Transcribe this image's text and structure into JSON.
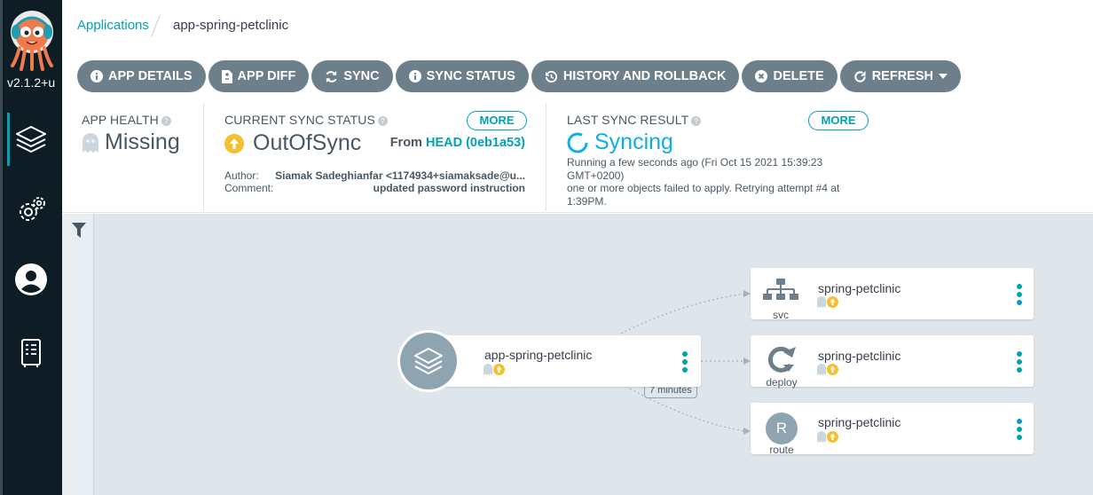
{
  "sidebar": {
    "version": "v2.1.2+u",
    "items": [
      {
        "name": "applications",
        "icon": "layers-icon",
        "active": true
      },
      {
        "name": "settings",
        "icon": "gears-icon",
        "active": false
      },
      {
        "name": "user-info",
        "icon": "user-icon",
        "active": false
      },
      {
        "name": "docs",
        "icon": "docs-icon",
        "active": false
      }
    ]
  },
  "breadcrumb": {
    "root": "Applications",
    "current": "app-spring-petclinic"
  },
  "toolbar": {
    "app_details": "APP DETAILS",
    "app_diff": "APP DIFF",
    "sync": "SYNC",
    "sync_status": "SYNC STATUS",
    "history": "HISTORY AND ROLLBACK",
    "delete": "DELETE",
    "refresh": "REFRESH"
  },
  "status": {
    "health": {
      "label": "APP HEALTH",
      "value": "Missing"
    },
    "sync": {
      "label": "CURRENT SYNC STATUS",
      "more": "MORE",
      "value": "OutOfSync",
      "from_prefix": "From",
      "revision": "HEAD (0eb1a53)",
      "author_label": "Author:",
      "author": "Siamak Sadeghianfar <1174934+siamaksade@u...",
      "comment_label": "Comment:",
      "comment": "updated password instruction"
    },
    "last_sync": {
      "label": "LAST SYNC RESULT",
      "more": "MORE",
      "value": "Syncing",
      "message": "Running a few seconds ago (Fri Oct 15 2021 15:39:23 GMT+0200)",
      "message2": "one or more objects failed to apply. Retrying attempt #4 at 1:39PM."
    }
  },
  "graph": {
    "app_node": {
      "title": "app-spring-petclinic"
    },
    "edge_label": "7 minutes",
    "resources": [
      {
        "title": "spring-petclinic",
        "kind": "svc",
        "icon": "svc-icon"
      },
      {
        "title": "spring-petclinic",
        "kind": "deploy",
        "icon": "deploy-icon"
      },
      {
        "title": "spring-petclinic",
        "kind": "route",
        "icon": "route-icon",
        "letter": "R"
      }
    ]
  },
  "colors": {
    "sidebar_bg": "#0e1c25",
    "accent": "#00a2b3",
    "button_bg": "#6d7f8b",
    "outofsync": "#f4c030",
    "syncing": "#0dadea",
    "canvas_bg": "#dee6eb"
  }
}
